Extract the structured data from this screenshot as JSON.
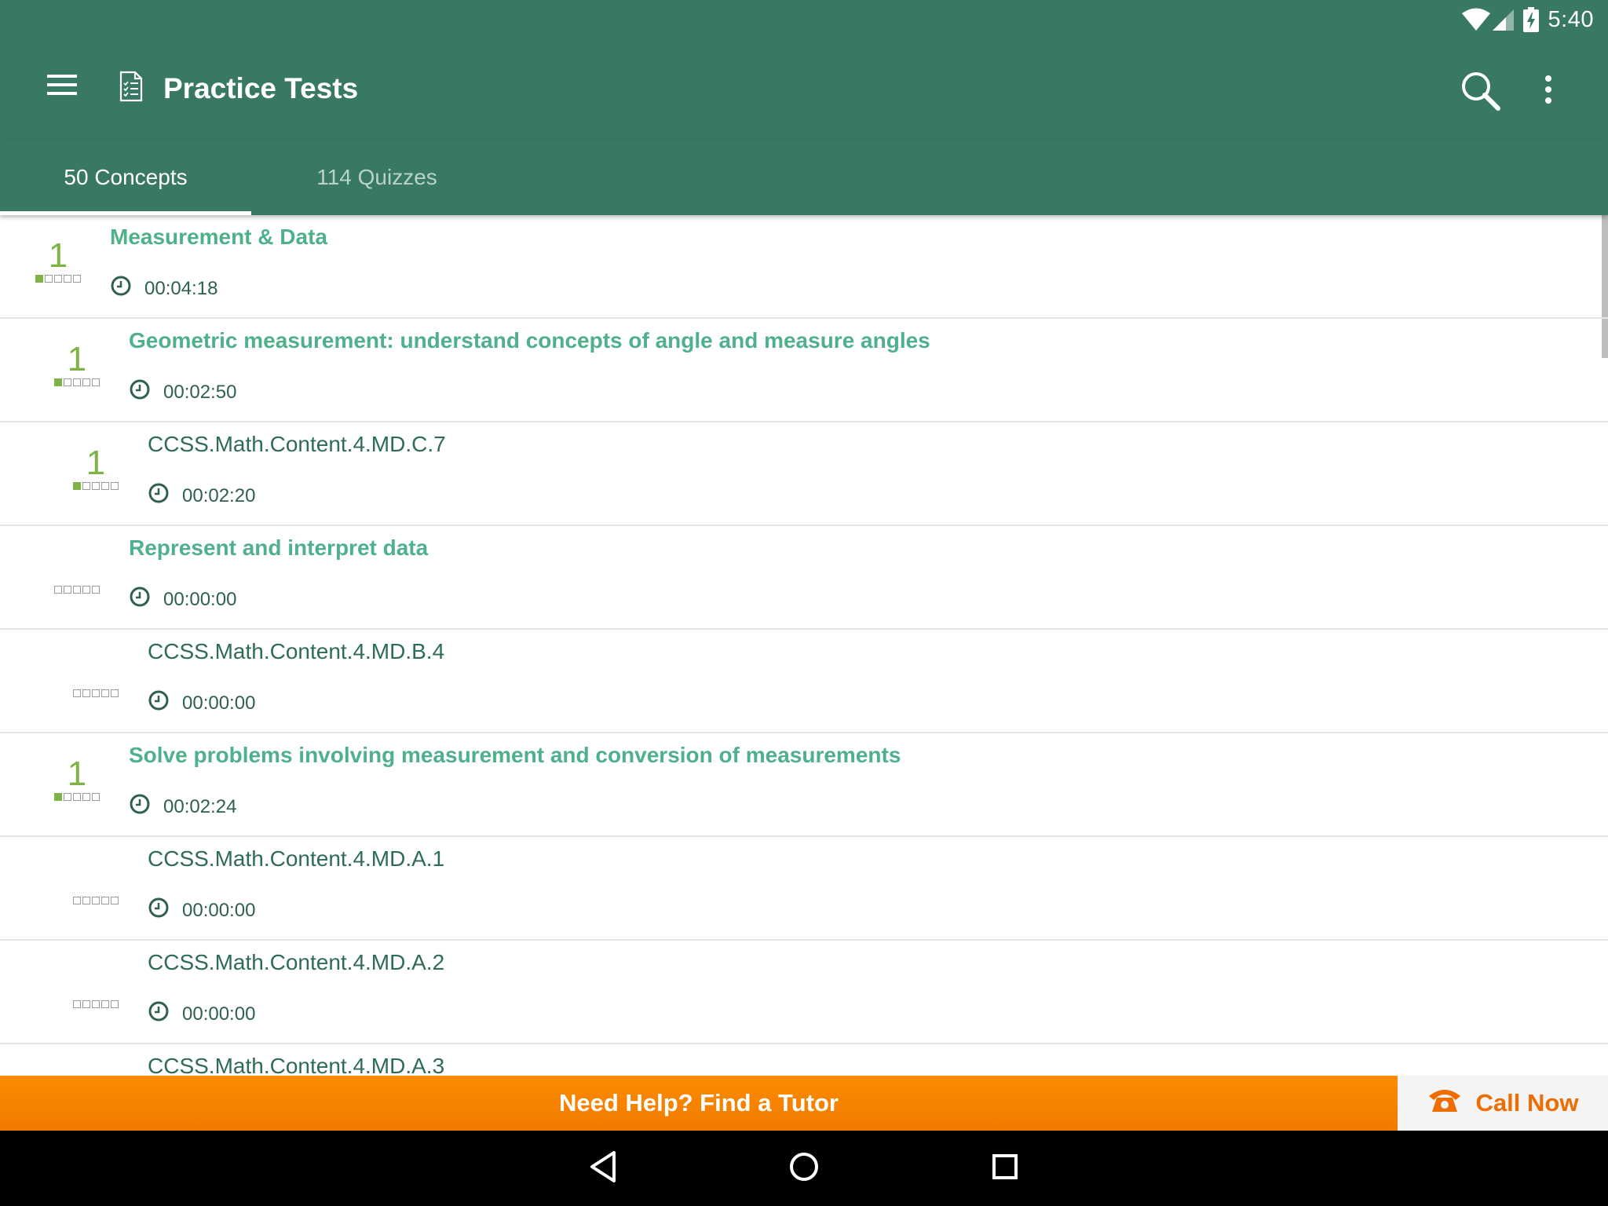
{
  "status_bar": {
    "time": "5:40"
  },
  "toolbar": {
    "title": "Practice Tests"
  },
  "tabs": [
    {
      "label": "50 Concepts",
      "active": true
    },
    {
      "label": "114 Quizzes",
      "active": false
    }
  ],
  "list": [
    {
      "kind": "concept",
      "indent": 0,
      "title": "Measurement & Data",
      "time": "00:04:18",
      "score": "1",
      "filled": 1
    },
    {
      "kind": "concept",
      "indent": 1,
      "title": "Geometric measurement: understand concepts of angle and measure angles",
      "time": "00:02:50",
      "score": "1",
      "filled": 1
    },
    {
      "kind": "standard",
      "indent": 2,
      "title": "CCSS.Math.Content.4.MD.C.7",
      "time": "00:02:20",
      "score": "1",
      "filled": 1
    },
    {
      "kind": "concept",
      "indent": 1,
      "title": "Represent and interpret data",
      "time": "00:00:00",
      "score": "",
      "filled": 0
    },
    {
      "kind": "standard",
      "indent": 2,
      "title": "CCSS.Math.Content.4.MD.B.4",
      "time": "00:00:00",
      "score": "",
      "filled": 0
    },
    {
      "kind": "concept",
      "indent": 1,
      "title": "Solve problems involving measurement and conversion of measurements",
      "time": "00:02:24",
      "score": "1",
      "filled": 1
    },
    {
      "kind": "standard",
      "indent": 2,
      "title": "CCSS.Math.Content.4.MD.A.1",
      "time": "00:00:00",
      "score": "",
      "filled": 0
    },
    {
      "kind": "standard",
      "indent": 2,
      "title": "CCSS.Math.Content.4.MD.A.2",
      "time": "00:00:00",
      "score": "",
      "filled": 0
    },
    {
      "kind": "standard",
      "indent": 2,
      "title": "CCSS.Math.Content.4.MD.A.3",
      "time": "",
      "score": "",
      "filled": 0
    }
  ],
  "banner": {
    "help_label": "Need Help? Find a Tutor",
    "call_label": "Call Now"
  },
  "icons": {
    "menu": "hamburger-menu-icon",
    "title": "document-checklist-icon",
    "search": "search-icon",
    "more": "more-vert-icon",
    "clock": "clock-icon",
    "phone": "phone-icon"
  },
  "colors": {
    "primary": "#387864",
    "concept_text": "#4fb08c",
    "standard_text": "#2e6b5b",
    "score_green": "#7cb342",
    "banner_orange": "#fb8c00",
    "call_orange": "#ef6c00"
  }
}
